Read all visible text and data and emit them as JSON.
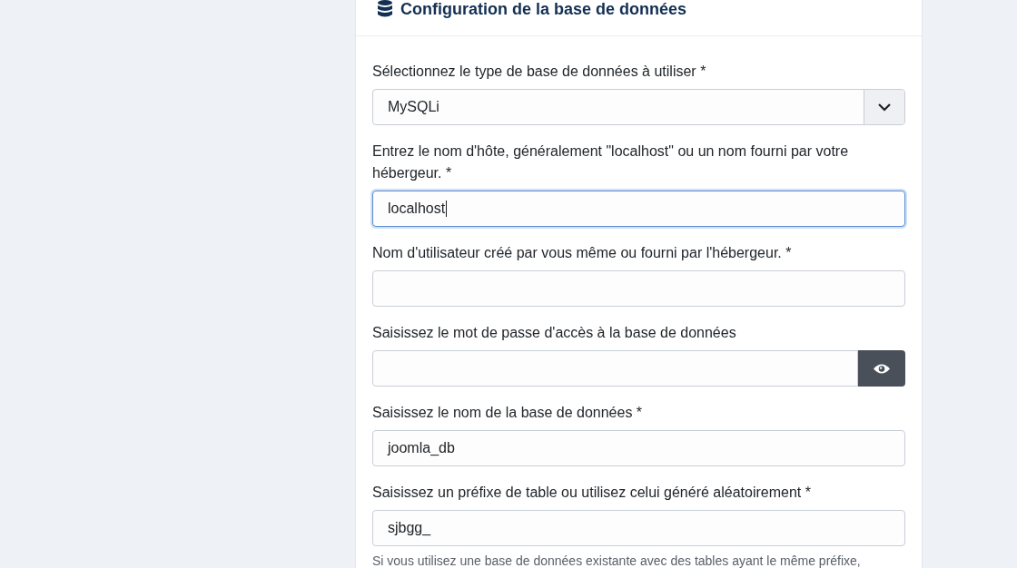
{
  "card": {
    "title": "Configuration de la base de données"
  },
  "fields": [
    {
      "kind": "select",
      "label": "Sélectionnez le type de base de données à utiliser *",
      "value": "MySQLi"
    },
    {
      "kind": "text",
      "label": "Entrez le nom d'hôte, généralement \"localhost\" ou un nom fourni par votre hébergeur. *",
      "value": "localhost",
      "focused": true
    },
    {
      "kind": "text",
      "label": "Nom d'utilisateur créé par vous même ou fourni par l'hébergeur. *",
      "focused": false
    },
    {
      "kind": "password",
      "label": "Saisissez le mot de passe d'accès à la base de données",
      "focused": false
    },
    {
      "kind": "text",
      "label": "Saisissez le nom de la base de données *",
      "value": "joomla_db",
      "focused": false
    },
    {
      "kind": "text",
      "label": "Saisissez un préfixe de table ou utilisez celui généré aléatoirement *",
      "value": "sjbgg_",
      "focused": false,
      "help": "Si vous utilisez une base de données existante avec des tables ayant le même préfixe,"
    }
  ]
}
